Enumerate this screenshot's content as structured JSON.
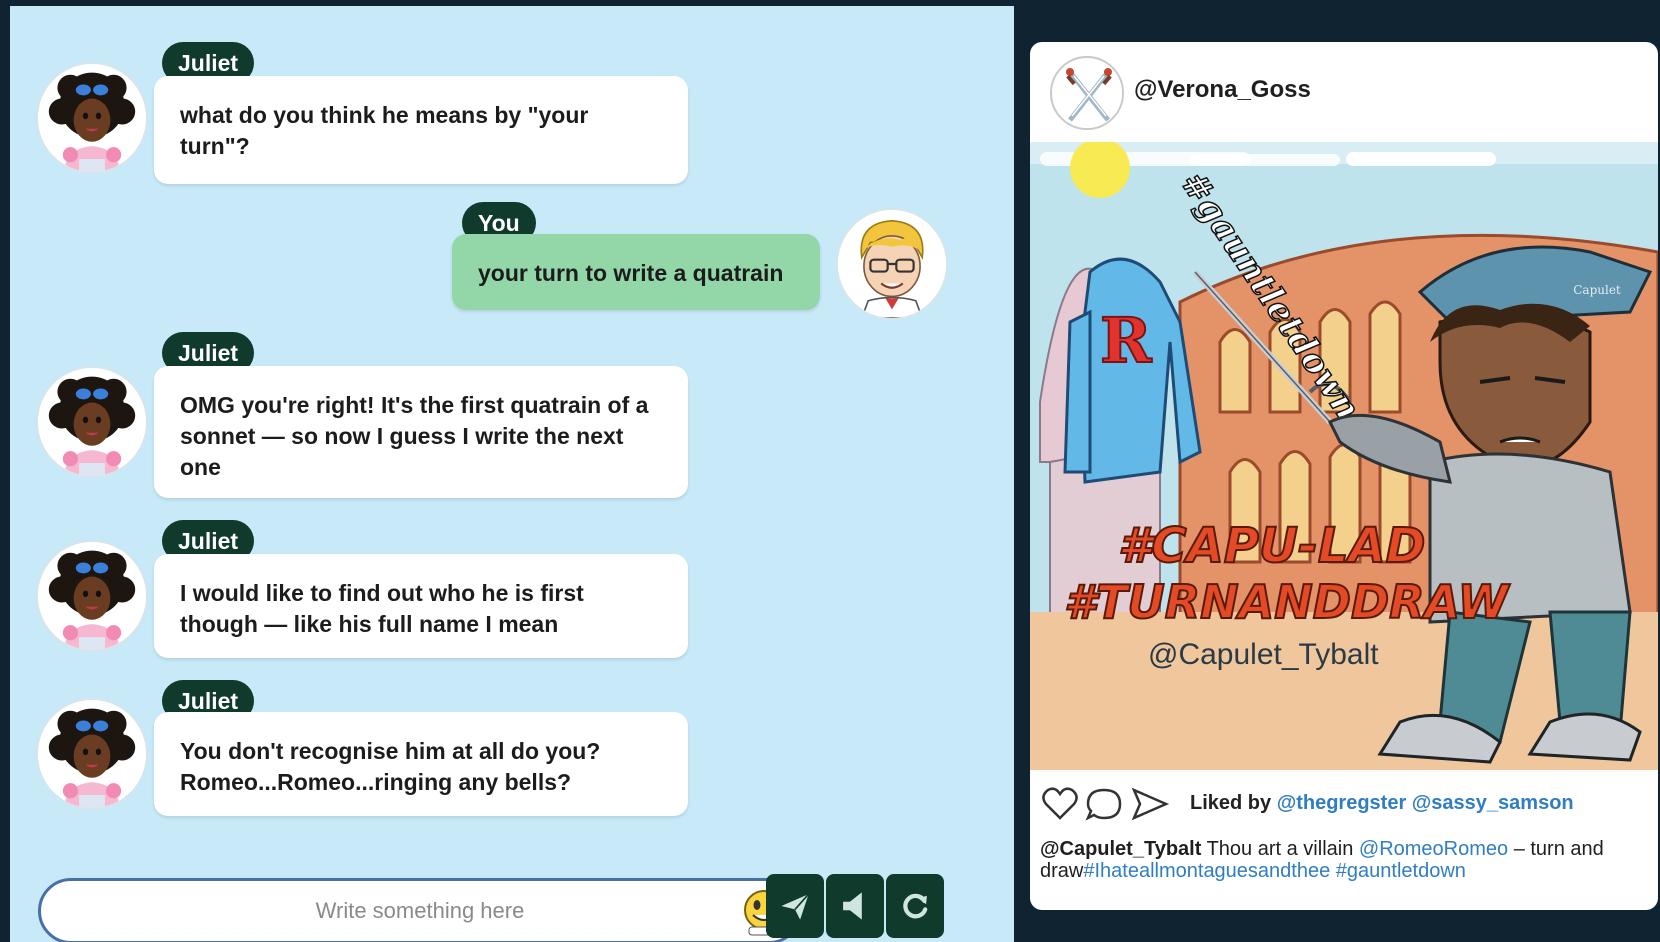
{
  "chat": {
    "messages": [
      {
        "sender": "Juliet",
        "text": "what do you think he means by \"your turn\"?"
      },
      {
        "sender": "You",
        "text": "your turn to write a quatrain"
      },
      {
        "sender": "Juliet",
        "text": "OMG you're right! It's the first quatrain of a sonnet — so now I guess I write the next one"
      },
      {
        "sender": "Juliet",
        "text": "I would like to find out who he is first though — like his full name I mean"
      },
      {
        "sender": "Juliet",
        "text": "You don't recognise him at all do you? Romeo...Romeo...ringing any bells?"
      }
    ],
    "input": {
      "placeholder": "Write something here"
    },
    "actions": {
      "send": "send-icon",
      "audio": "speaker-icon",
      "reset": "refresh-icon"
    }
  },
  "post": {
    "username": "@Verona_Goss",
    "image_text": {
      "hashtag_1": "#gauntletdown",
      "hashtag_2": "#CAPU-LAD",
      "hashtag_3": "#TURNANDDRAW",
      "handle": "@Capulet_Tybalt",
      "jacket_letter": "R",
      "cap_badge": "Capulet"
    },
    "liked_by_label": "Liked by",
    "liked_by_users": [
      "@thegregster",
      "@sassy_samson"
    ],
    "caption": {
      "author": "@Capulet_Tybalt",
      "text_1": " Thou art a villain ",
      "mention": "@RomeoRomeo",
      "text_2": " – turn and draw",
      "tags": "#Ihateallmontaguesandthee #gauntletdown"
    }
  },
  "colors": {
    "chat_bg": "#c8e9f8",
    "name_tag": "#103a2c",
    "you_bubble": "#93d7a9",
    "page_bg": "#0f2331",
    "link": "#2f7ec4"
  }
}
